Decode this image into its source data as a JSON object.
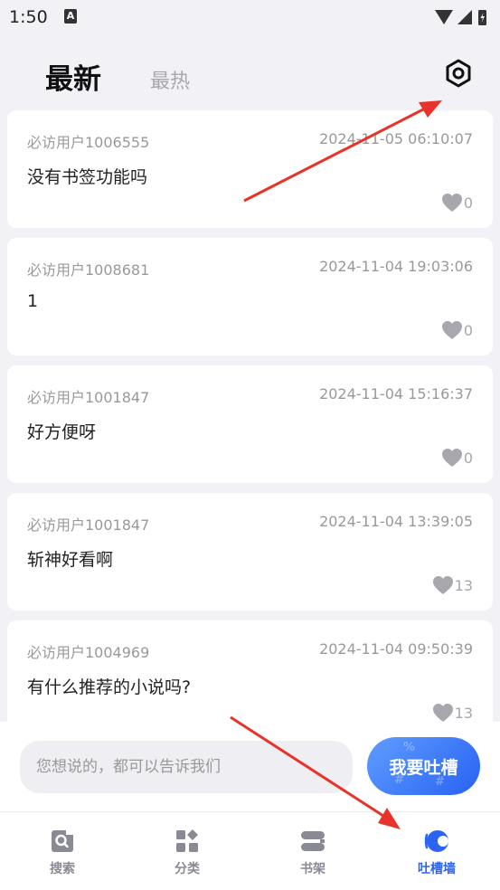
{
  "status_bar": {
    "time": "1:50",
    "notification_icon": "A"
  },
  "header": {
    "tab_latest": "最新",
    "tab_hot": "最热",
    "settings_icon": "gear-icon"
  },
  "posts": [
    {
      "user": "必访用户1006555",
      "time": "2024-11-05 06:10:07",
      "content": "没有书签功能吗",
      "likes": "0"
    },
    {
      "user": "必访用户1008681",
      "time": "2024-11-04 19:03:06",
      "content": "1",
      "likes": "0"
    },
    {
      "user": "必访用户1001847",
      "time": "2024-11-04 15:16:37",
      "content": "好方便呀",
      "likes": "0"
    },
    {
      "user": "必访用户1001847",
      "time": "2024-11-04 13:39:05",
      "content": "斩神好看啊",
      "likes": "13"
    },
    {
      "user": "必访用户1004969",
      "time": "2024-11-04 09:50:39",
      "content": "有什么推荐的小说吗?",
      "likes": "13"
    }
  ],
  "compose": {
    "placeholder": "您想说的，都可以告诉我们",
    "button_label": "我要吐槽"
  },
  "nav": [
    {
      "label": "搜索",
      "icon": "search-icon"
    },
    {
      "label": "分类",
      "icon": "category-icon"
    },
    {
      "label": "书架",
      "icon": "bookshelf-icon"
    },
    {
      "label": "吐槽墙",
      "icon": "feedback-wall-icon",
      "active": true
    }
  ],
  "colors": {
    "accent": "#2a64f0",
    "annotation_arrow": "#e8332a",
    "muted_text": "#999999",
    "background": "#f2f2f6"
  }
}
